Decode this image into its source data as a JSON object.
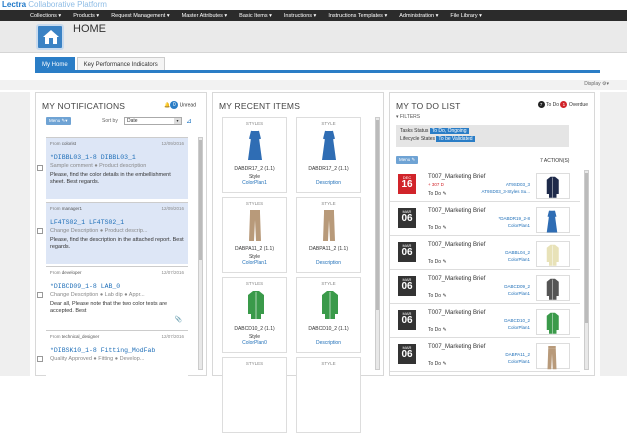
{
  "brand": {
    "part1": "Lectra",
    "part2": "Collaborative Platform"
  },
  "menu": [
    "Collections ▾",
    "Products ▾",
    "Request Management ▾",
    "Master Attributes ▾",
    "Basic Items ▾",
    "Instructions ▾",
    "Instructions Templates ▾",
    "Administration ▾",
    "File Library ▾"
  ],
  "header": {
    "title": "HOME"
  },
  "tabs": [
    "My Home",
    "Key Performance Indicators"
  ],
  "display": "Display",
  "notifications": {
    "title": "MY NOTIFICATIONS",
    "unread_count": "0",
    "unread_label": "Unread",
    "menu_label": "Menu",
    "sort_label": "Sort by",
    "sort_value": "Date",
    "cards": [
      {
        "from_label": "From",
        "from": "colorist",
        "date": "12/09/2016",
        "code": "*DIBBL03_1-8 DIBBL03_1",
        "sub": "Sample comment  ● Product description",
        "msg": "Please, find the color details in the embellishment sheet. Best regards.",
        "unread": true
      },
      {
        "from_label": "From",
        "from": "manager1",
        "date": "12/09/2016",
        "code": "LF4TS02_1 LF4TS02_1",
        "sub": "Change Description  ● Product descrip...",
        "msg": "Please, find the description in the attached report. Best regards.",
        "unread": true
      },
      {
        "from_label": "From",
        "from": "developer",
        "date": "12/07/2016",
        "code": "*DIBCD09_1-8 LAB_0",
        "sub": "Change Description  ● Lab dip  ● Appr...",
        "msg": "Dear all, Please note that the two color tests are accepted. Best",
        "unread": false
      },
      {
        "from_label": "From",
        "from": "technical_designer",
        "date": "12/07/2016",
        "code": "*DIBSK10_1-8 Fitting_ModFab",
        "sub": "Quality Approved  ● Fitting  ● Develop...",
        "msg": "",
        "unread": false
      }
    ]
  },
  "recent": {
    "title": "MY RECENT ITEMS",
    "items": [
      {
        "label": "STYLES",
        "name": "DABDR17_2 (1.1)",
        "kind": "Style",
        "link": "ColorPlan1",
        "color": "#2f6db4",
        "shape": "dress"
      },
      {
        "label": "STYLE",
        "name": "DABDR17_2 (1.1)",
        "kind": "",
        "link": "Description",
        "color": "#2f6db4",
        "shape": "dress"
      },
      {
        "label": "STYLES",
        "name": "DABPA11_2 (1.1)",
        "kind": "Style",
        "link": "ColorPlan1",
        "color": "#b89a7a",
        "shape": "pants"
      },
      {
        "label": "STYLE",
        "name": "DABPA11_2 (1.1)",
        "kind": "",
        "link": "Description",
        "color": "#b89a7a",
        "shape": "pants"
      },
      {
        "label": "STYLES",
        "name": "DABCD10_2 (1.1)",
        "kind": "Style",
        "link": "ColorPlan0",
        "color": "#3a9a4a",
        "shape": "jacket"
      },
      {
        "label": "STYLE",
        "name": "DABCD10_2 (1.1)",
        "kind": "",
        "link": "Description",
        "color": "#3a9a4a",
        "shape": "jacket"
      },
      {
        "label": "STYLES",
        "name": "",
        "kind": "",
        "link": "",
        "color": "#888888",
        "shape": "none"
      },
      {
        "label": "STYLE",
        "name": "",
        "kind": "",
        "link": "",
        "color": "#888888",
        "shape": "none"
      }
    ]
  },
  "todo": {
    "title": "MY TO DO LIST",
    "legend_todo": "To Do",
    "legend_overdue": "Overdue",
    "todo_count": "7",
    "overdue_count": "1",
    "filters_label": "FILTERS",
    "task_status_label": "Tasks Status",
    "task_status_value": "To Do, Ongoing",
    "lifecycle_label": "Lifecycle States",
    "lifecycle_value": "To be Validated",
    "menu_label": "Menu",
    "actions": "7 ACTION(S)",
    "items": [
      {
        "month": "DEC",
        "day": "16",
        "title": "T007_Marketing Brief",
        "late": "+ 307 D",
        "todo": "To Do",
        "ref1": "AT9SD03_3",
        "ref2": "AT9SD03_3-Styles Su...",
        "overdue": true,
        "color": "#1e2a4a",
        "shape": "jacket"
      },
      {
        "month": "MAR",
        "day": "06",
        "title": "T007_Marketing Brief",
        "late": "",
        "todo": "To Do",
        "ref1": "*DABDR19_2-8",
        "ref2": "ColorPlan1",
        "overdue": false,
        "color": "#2f6db4",
        "shape": "dress"
      },
      {
        "month": "MAR",
        "day": "06",
        "title": "T007_Marketing Brief",
        "late": "",
        "todo": "To Do",
        "ref1": "DABBL04_2",
        "ref2": "ColorPlan1",
        "overdue": false,
        "color": "#e8e2b8",
        "shape": "jacket"
      },
      {
        "month": "MAR",
        "day": "06",
        "title": "T007_Marketing Brief",
        "late": "",
        "todo": "To Do",
        "ref1": "DABCD09_2",
        "ref2": "ColorPlan1",
        "overdue": false,
        "color": "#555555",
        "shape": "jacket"
      },
      {
        "month": "MAR",
        "day": "06",
        "title": "T007_Marketing Brief",
        "late": "",
        "todo": "To Do",
        "ref1": "DABCD10_2",
        "ref2": "ColorPlan1",
        "overdue": false,
        "color": "#3a9a4a",
        "shape": "jacket"
      },
      {
        "month": "MAR",
        "day": "06",
        "title": "T007_Marketing Brief",
        "late": "",
        "todo": "To Do",
        "ref1": "DABPA11_2",
        "ref2": "ColorPlan1",
        "overdue": false,
        "color": "#b89a7a",
        "shape": "pants"
      }
    ]
  },
  "colors": {
    "accent": "#2a7dc6",
    "overdue": "#d1242a",
    "todo": "#222222"
  }
}
